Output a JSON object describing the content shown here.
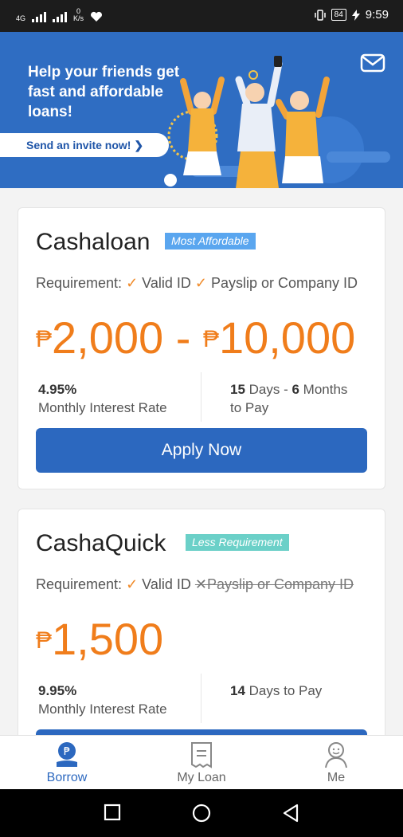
{
  "status_bar": {
    "network_left": "4G",
    "speed_value": "0",
    "speed_unit": "K/s",
    "battery": "84",
    "time": "9:59"
  },
  "banner": {
    "title": "Help your friends get fast and affordable loans!",
    "invite_label": "Send an invite now! ❯",
    "mail_icon": "mail-icon"
  },
  "loans": [
    {
      "name": "Cashaloan",
      "tag": "Most Affordable",
      "tag_color": "#5aa6ef",
      "requirement_label": "Requirement:",
      "req1": "Valid ID",
      "req2": "Payslip or Company ID",
      "amount_from": "2,000",
      "amount_to": "10,000",
      "rate_value": "4.95%",
      "rate_label": "Monthly Interest Rate",
      "term_a": "15",
      "term_a_unit": " Days - ",
      "term_b": "6",
      "term_b_unit": " Months",
      "term_label": "to Pay",
      "apply_label": "Apply Now"
    },
    {
      "name": "CashaQuick",
      "tag": "Less Requirement",
      "tag_color": "#6bd0c8",
      "requirement_label": "Requirement:",
      "req1": "Valid ID",
      "req2": "Payslip or Company ID",
      "amount": "1,500",
      "rate_value": "9.95%",
      "rate_label": "Monthly Interest Rate",
      "term_a": "14",
      "term_label": " Days to Pay"
    }
  ],
  "currency_symbol": "₱",
  "bottom_nav": [
    {
      "label": "Borrow",
      "icon": "borrow-icon",
      "active": true
    },
    {
      "label": "My Loan",
      "icon": "receipt-icon",
      "active": false
    },
    {
      "label": "Me",
      "icon": "profile-icon",
      "active": false
    }
  ],
  "colors": {
    "brand_blue": "#2c68bf",
    "amount_orange": "#f07d1b",
    "banner_blue": "#2f6dc2"
  }
}
